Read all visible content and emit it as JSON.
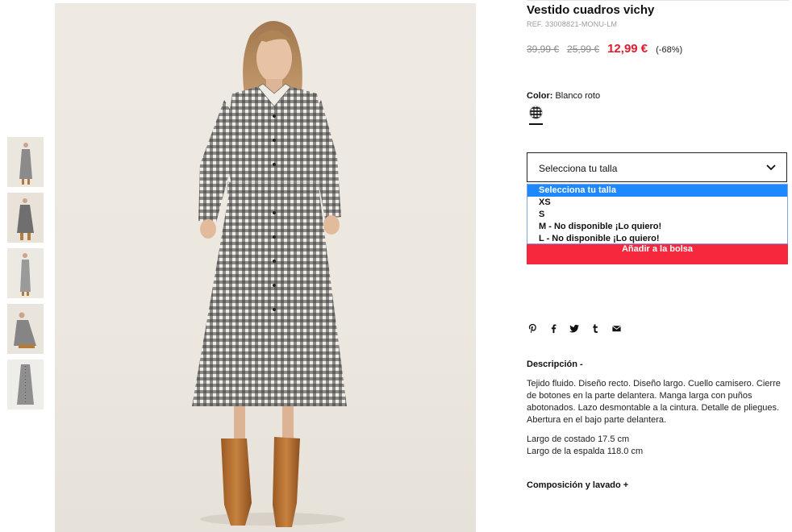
{
  "product": {
    "title": "Vestido cuadros vichy",
    "ref": "REF. 33008821-MONU-LM",
    "price_original": "39,99 €",
    "price_previous": "25,99 €",
    "price_current": "12,99 €",
    "discount": "(-68%)"
  },
  "color": {
    "label": "Color:",
    "value": "Blanco roto"
  },
  "size_select": {
    "label": "Selecciona tu talla",
    "options": [
      "Selecciona tu talla",
      "XS",
      "S",
      "M - No disponible ¡Lo quiero!",
      "L - No disponible ¡Lo quiero!"
    ],
    "selected_index": 0
  },
  "add_to_bag": "Añadir a la bolsa",
  "share_icons": [
    "pinterest-icon",
    "facebook-icon",
    "twitter-icon",
    "tumblr-icon",
    "email-icon"
  ],
  "description": {
    "heading": "Descripción -",
    "text": "Tejido fluido. Diseño recto. Diseño largo. Cuello camisero. Cierre de botones en la parte delantera. Manga larga con puños abotonados. Lazo desmontable a la cintura. Detalle de pliegues. Abertura en el bajo parte delantera.",
    "measure_1": "Largo de costado 17.5 cm",
    "measure_2": "Largo de la espalda 118.0 cm"
  },
  "composition_heading": "Composición y lavado +",
  "colors": {
    "price_red": "#e31b2c",
    "button_red": "#f5283d",
    "dropdown_highlight": "#1e88ff"
  }
}
